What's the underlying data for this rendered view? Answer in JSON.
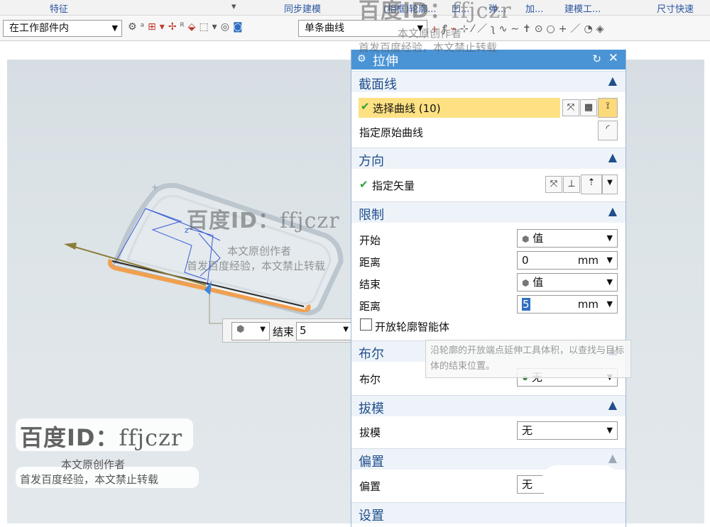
{
  "menubar": {
    "items": [
      "特征",
      "同步建模",
      "(相框)轮廓...",
      "凹...",
      "弹...",
      "加...",
      "建模工...",
      "尺寸快速"
    ]
  },
  "toolbar": {
    "filter_scope": "在工作部件内",
    "curve_rule": "单条曲线"
  },
  "dialog": {
    "title": "拉伸",
    "section_curve": {
      "heading": "截面线",
      "select_curve_label": "选择曲线 (10)",
      "specify_original_curve": "指定原始曲线"
    },
    "section_direction": {
      "heading": "方向",
      "specify_vector": "指定矢量"
    },
    "section_limits": {
      "heading": "限制",
      "start_label": "开始",
      "start_value": "值",
      "start_distance_label": "距离",
      "start_distance": "0",
      "start_unit": "mm",
      "end_label": "结束",
      "end_value": "值",
      "end_distance_label": "距离",
      "end_distance": "5",
      "end_unit": "mm",
      "open_profile_label": "开放轮廓智能体"
    },
    "section_boolean": {
      "heading": "布尔",
      "label": "布尔",
      "value": "无"
    },
    "section_draft": {
      "heading": "拔模",
      "label": "拔模",
      "value": "无"
    },
    "section_offset": {
      "heading": "偏置",
      "label": "偏置",
      "value": "无"
    },
    "section_settings": {
      "heading": "设置"
    }
  },
  "tooltip": {
    "text": "沿轮廓的开放端点延伸工具体积，以查找与目标体的结束位置。"
  },
  "end_float": {
    "label": "结束",
    "value": "5"
  },
  "watermark": {
    "brand": "百度ID：",
    "id": "ffjczr",
    "line1": "本文原创作者",
    "line2": "首发百度经验，本文禁止转载"
  },
  "colors": {
    "title_bar": "#4a94d6",
    "selected_row": "#fde183",
    "section_header_text": "#1f4f8c",
    "model_highlight": "#f0a050"
  }
}
